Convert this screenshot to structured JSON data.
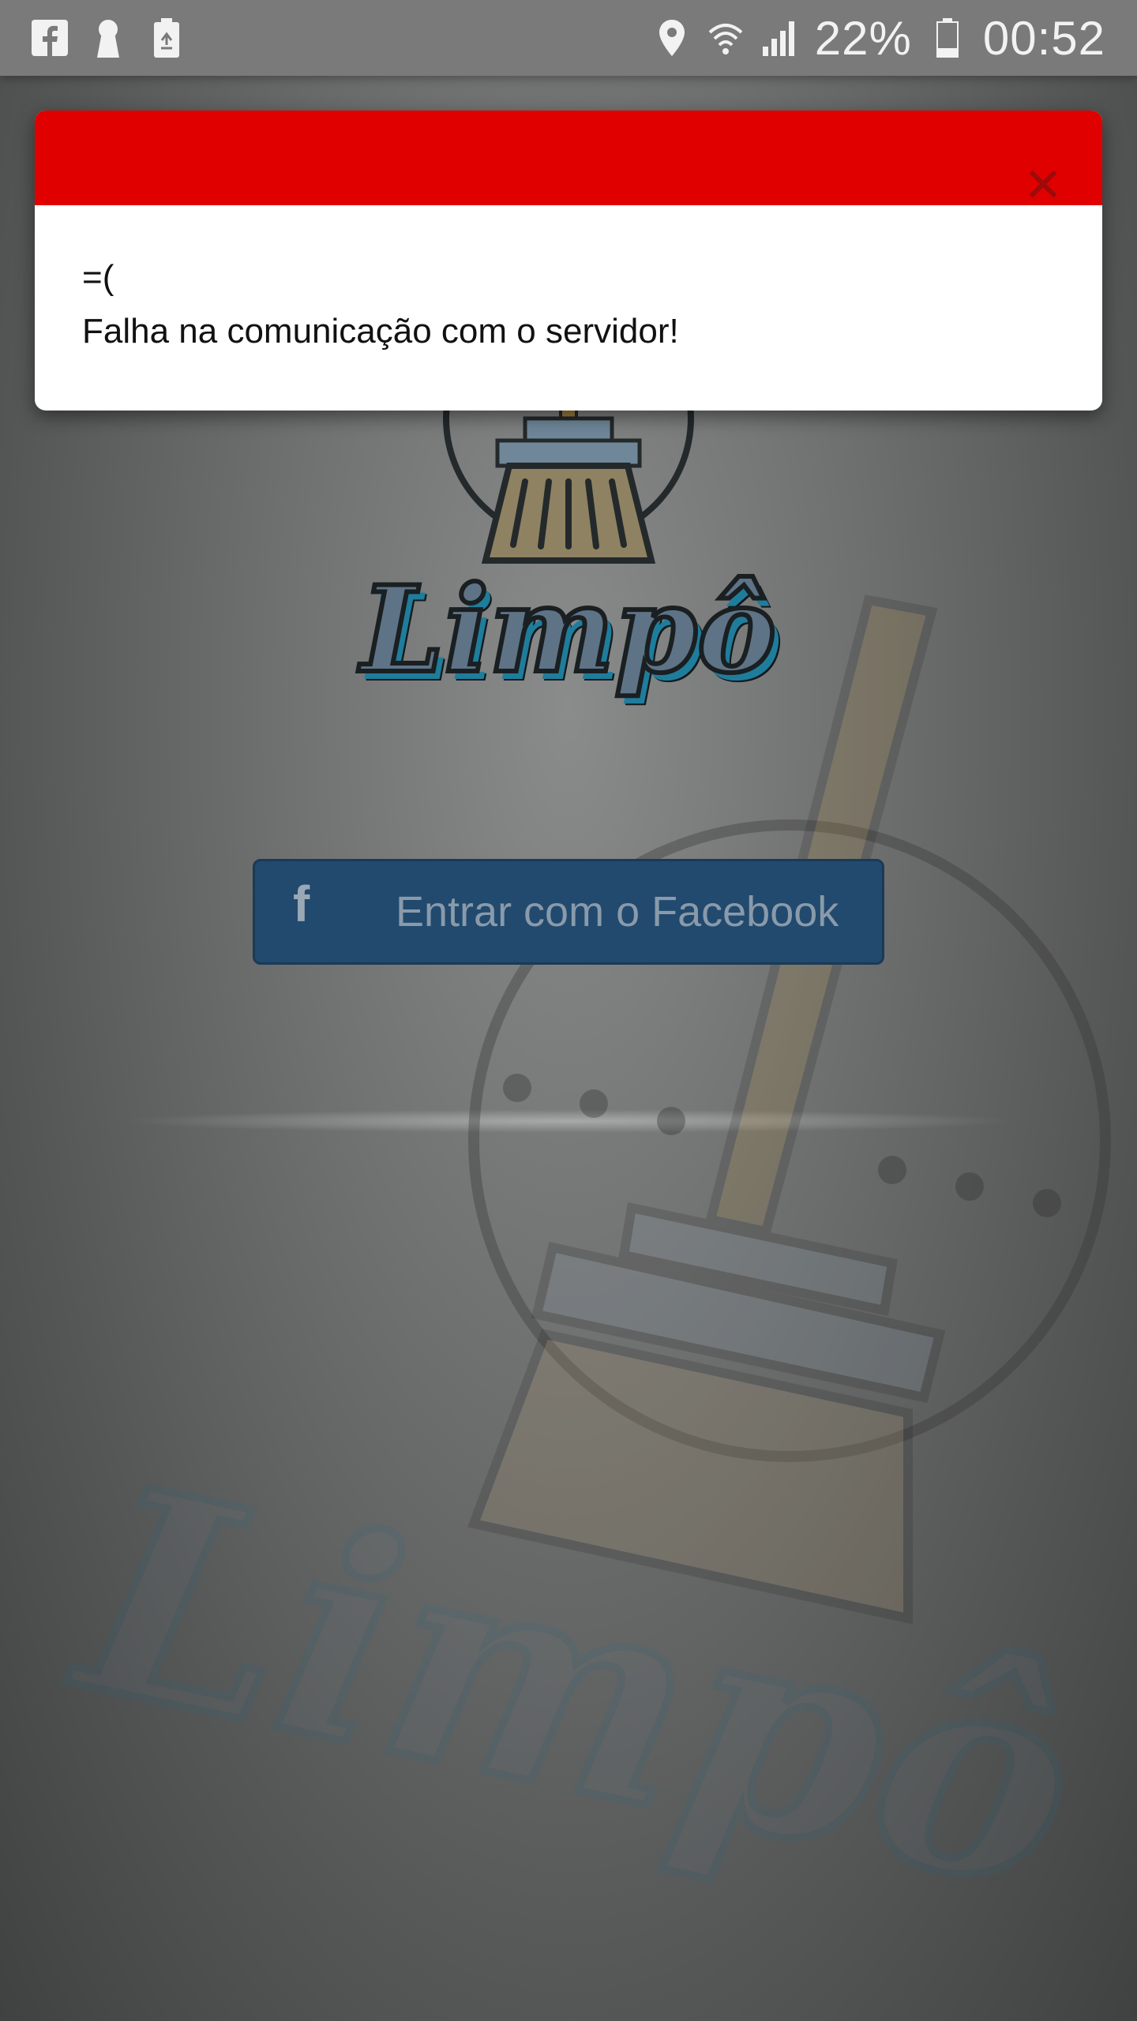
{
  "status_bar": {
    "left_icons": [
      "facebook-notification-icon",
      "keyhole-icon",
      "battery-saver-icon"
    ],
    "right_icons": [
      "location-icon",
      "wifi-icon",
      "signal-icon",
      "battery-icon"
    ],
    "battery_percent": "22%",
    "time": "00:52"
  },
  "app": {
    "name": "Limpô",
    "brand_colors": {
      "accent": "#1f7d9c",
      "facebook": "#214a6e",
      "alert_header": "#e00000"
    }
  },
  "login": {
    "facebook_button_label": "Entrar com o Facebook",
    "facebook_icon": "f"
  },
  "alert": {
    "close_symbol": "✕",
    "emoticon": "=(",
    "message": "Falha na comunicação com o servidor!"
  }
}
